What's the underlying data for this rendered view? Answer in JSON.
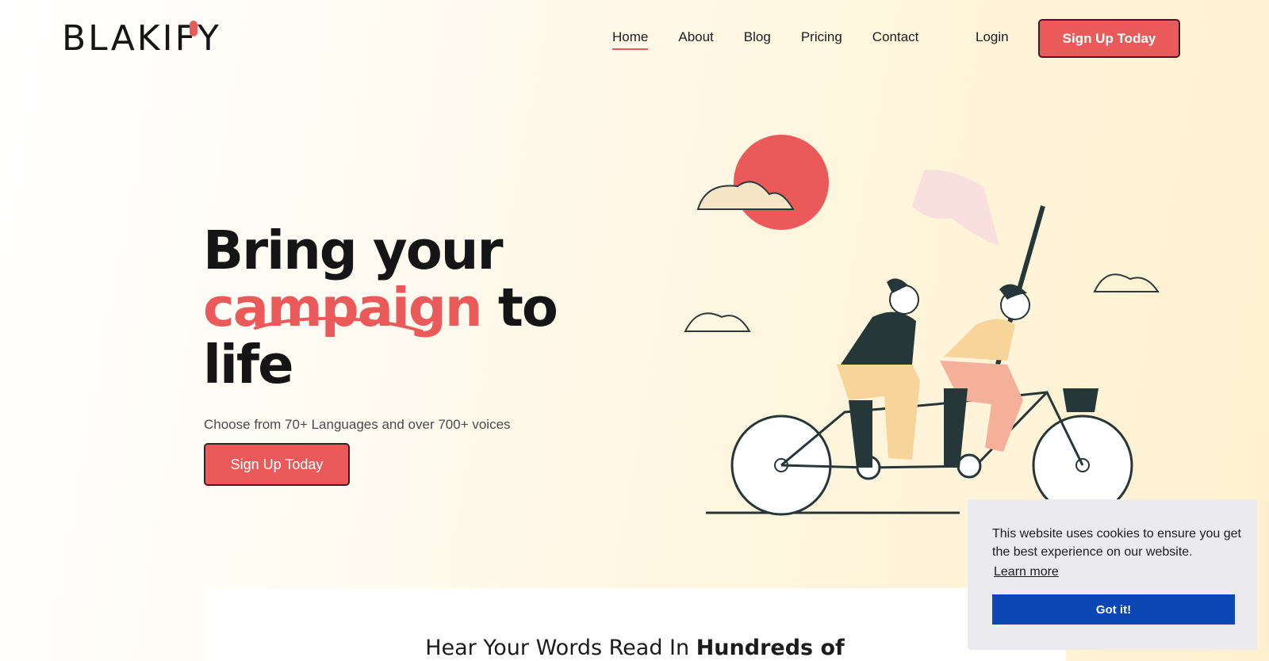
{
  "brand": {
    "name": "BLAKIFY",
    "accent_color": "#ea5a5a"
  },
  "nav": {
    "items": [
      {
        "label": "Home",
        "active": true
      },
      {
        "label": "About",
        "active": false
      },
      {
        "label": "Blog",
        "active": false
      },
      {
        "label": "Pricing",
        "active": false
      },
      {
        "label": "Contact",
        "active": false
      }
    ],
    "login_label": "Login",
    "cta_label": "Sign Up Today"
  },
  "hero": {
    "title_line1": "Bring your",
    "title_accent": "campaign",
    "title_line2_rest": " to",
    "title_line3": "life",
    "subtitle": "Choose from 70+ Languages and over 700+ voices",
    "cta_label": "Sign Up Today",
    "illustration": "two-people-riding-tandem-bicycle-with-flag"
  },
  "section": {
    "heading_plain": "Hear Your Words Read In ",
    "heading_bold": "Hundreds of"
  },
  "cookie": {
    "message": "This website uses cookies to ensure you get the best experience on our website.",
    "learn_more": "Learn more",
    "accept": "Got it!",
    "accept_color": "#0b46b5"
  }
}
